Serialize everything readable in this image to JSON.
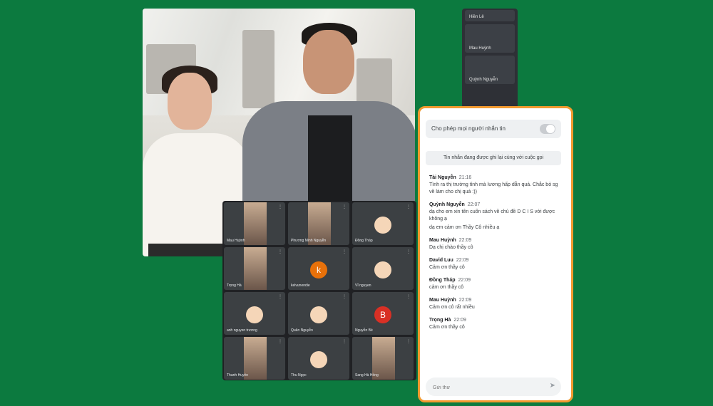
{
  "participants_strip": [
    {
      "name": "Hiền Lê"
    },
    {
      "name": "Mau Huỳnh"
    },
    {
      "name": "Quỳnh Nguyễn"
    }
  ],
  "grid": [
    {
      "name": "Mau Huỳnh",
      "avatar": "photo"
    },
    {
      "name": "Phương Minh Nguyễn",
      "avatar": "photo"
    },
    {
      "name": "Đồng Tháp",
      "avatar": "emoji"
    },
    {
      "name": "Trọng Hà",
      "avatar": "photo"
    },
    {
      "name": "kelvunendie",
      "avatar": "letter",
      "letter": "k",
      "color": "#e8710a"
    },
    {
      "name": "Vĩ nguyen",
      "avatar": "emoji"
    },
    {
      "name": "anh nguyen trương",
      "avatar": "emoji"
    },
    {
      "name": "Quân Nguyễn",
      "avatar": "emoji"
    },
    {
      "name": "Nguyễn Bé",
      "avatar": "letter",
      "letter": "B",
      "color": "#d93025"
    },
    {
      "name": "Thanh Huyền",
      "avatar": "photo"
    },
    {
      "name": "Thu Ngọc",
      "avatar": "emoji"
    },
    {
      "name": "Sang Hà Hồng",
      "avatar": "photo"
    }
  ],
  "chat": {
    "toggle_label": "Cho phép mọi người nhắn tin",
    "notice": "Tin nhắn đang được ghi lại cùng với cuộc gọi",
    "messages": [
      {
        "sender": "Tài Nguyễn",
        "time": "21:16",
        "lines": [
          "Tình ra thị trường tỉnh mà lương hấp dẫn quá. Chắc bỏ sg về làm cho chị quá :))"
        ]
      },
      {
        "sender": "Quỳnh Nguyễn",
        "time": "22:07",
        "lines": [
          "dạ cho em xin tên cuốn sách về chủ đề D C I S với được không ạ",
          "dạ em cảm ơn Thầy Cô nhiều ạ"
        ]
      },
      {
        "sender": "Mau Huỳnh",
        "time": "22:09",
        "lines": [
          "Dạ chị chào thầy cô"
        ]
      },
      {
        "sender": "David Luu",
        "time": "22:09",
        "lines": [
          "Cảm ơn thầy cô"
        ]
      },
      {
        "sender": "Đồng Tháp",
        "time": "22:09",
        "lines": [
          "cảm ơn thầy cô"
        ]
      },
      {
        "sender": "Mau Huỳnh",
        "time": "22:09",
        "lines": [
          "Cảm ơn cô rất nhiều"
        ]
      },
      {
        "sender": "Trọng Hà",
        "time": "22:09",
        "lines": [
          "Cảm ơn thầy cô"
        ]
      }
    ],
    "composer_placeholder": "Gửi thư"
  }
}
